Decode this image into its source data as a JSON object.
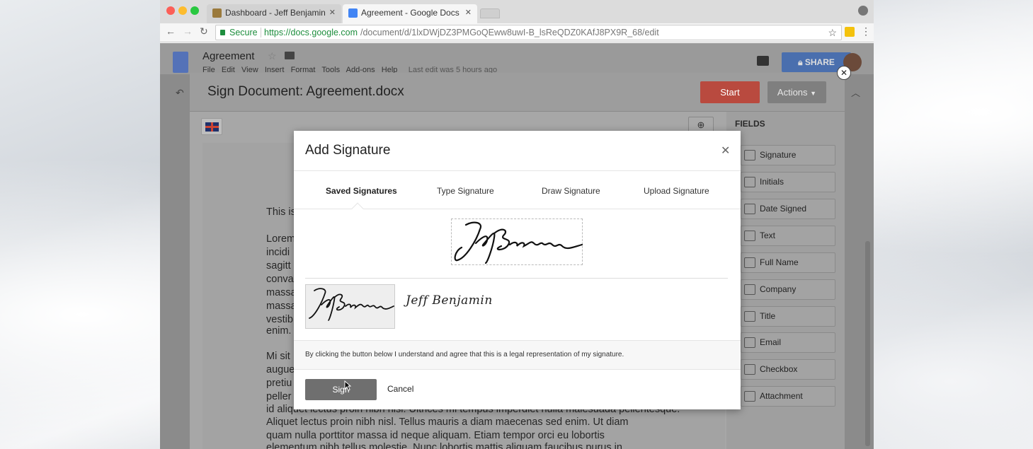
{
  "browser": {
    "tabs": [
      {
        "title": "Dashboard - Jeff Benjamin"
      },
      {
        "title": "Agreement - Google Docs"
      }
    ],
    "omnibox": {
      "secure_label": "Secure",
      "url_host": "https://docs.google.com",
      "url_path": "/document/d/1lxDWjDZ3PMGoQEww8uwI-B_lsReQDZ0KAfJ8PX9R_68/edit"
    }
  },
  "docs": {
    "title": "Agreement",
    "menu": [
      "File",
      "Edit",
      "View",
      "Insert",
      "Format",
      "Tools",
      "Add-ons",
      "Help"
    ],
    "last_edit": "Last edit was 5 hours ago",
    "share_label": "SHARE"
  },
  "signer": {
    "title": "Sign Document: Agreement.docx",
    "start_label": "Start",
    "actions_label": "Actions",
    "fields_heading": "FIELDS",
    "fields": [
      {
        "label": "Signature",
        "icon": "signature-icon"
      },
      {
        "label": "Initials",
        "icon": "initials-icon"
      },
      {
        "label": "Date Signed",
        "icon": "calendar-icon"
      },
      {
        "label": "Text",
        "icon": "text-icon"
      },
      {
        "label": "Full Name",
        "icon": "person-icon"
      },
      {
        "label": "Company",
        "icon": "building-icon"
      },
      {
        "label": "Title",
        "icon": "id-card-icon"
      },
      {
        "label": "Email",
        "icon": "envelope-icon"
      },
      {
        "label": "Checkbox",
        "icon": "checkbox-icon"
      },
      {
        "label": "Attachment",
        "icon": "paperclip-icon"
      }
    ],
    "doc_lines": [
      "This is",
      "Lorem",
      "incidi",
      "sagitt",
      "conva",
      "massa",
      "massa",
      "vestib",
      "enim.",
      "Mi sit",
      "augue",
      "pretiu",
      "peller",
      "id aliquet lectus proin nibh nisl. Ultrices mi tempus imperdiet nulla malesuada pellentesque.",
      "Aliquet lectus proin nibh nisl. Tellus mauris a diam maecenas sed enim. Ut diam",
      "quam nulla porttitor massa id neque aliquam. Etiam tempor orci eu lobortis",
      "elementum nibh tellus molestie. Nunc lobortis mattis aliquam faucibus purus in"
    ]
  },
  "dialog": {
    "title": "Add Signature",
    "tabs": [
      "Saved Signatures",
      "Type Signature",
      "Draw Signature",
      "Upload Signature"
    ],
    "active_tab": "Saved Signatures",
    "saved_signature_text": "Jeff Benjamin",
    "disclaimer": "By clicking the button below I understand and agree that this is a legal representation of my signature.",
    "sign_label": "Sign",
    "cancel_label": "Cancel"
  }
}
